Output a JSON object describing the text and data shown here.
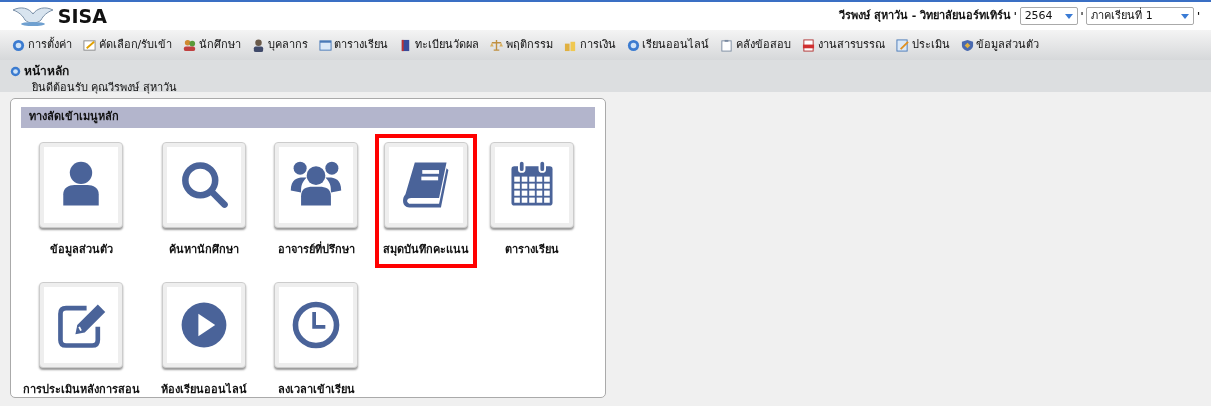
{
  "header": {
    "logo_text": "SISA",
    "user_school": "วีรพงษ์ สุหาวัน - วิทยาลัยนอร์ทเทิร์น",
    "separators": [
      "'",
      "'",
      "'"
    ],
    "year_select": {
      "value": "2564"
    },
    "term_select": {
      "value": "ภาคเรียนที่ 1"
    }
  },
  "menu": [
    {
      "label": "การตั้งค่า"
    },
    {
      "label": "คัดเลือก/รับเข้า"
    },
    {
      "label": "นักศึกษา"
    },
    {
      "label": "บุคลากร"
    },
    {
      "label": "ตารางเรียน"
    },
    {
      "label": "ทะเบียนวัดผล"
    },
    {
      "label": "พฤติกรรม"
    },
    {
      "label": "การเงิน"
    },
    {
      "label": "เรียนออนไลน์"
    },
    {
      "label": "คลังข้อสอบ"
    },
    {
      "label": "งานสารบรรณ"
    },
    {
      "label": "ประเมิน"
    },
    {
      "label": "ข้อมูลส่วนตัว"
    }
  ],
  "breadcrumb": {
    "title": "หน้าหลัก",
    "welcome": "ยินดีต้อนรับ คุณวีรพงษ์ สุหาวัน"
  },
  "shortcuts": {
    "title": "ทางลัดเข้าเมนูหลัก",
    "items": [
      {
        "label": "ข้อมูลส่วนตัว",
        "highlighted": false
      },
      {
        "label": "ค้นหานักศึกษา",
        "highlighted": false
      },
      {
        "label": "อาจารย์ที่ปรึกษา",
        "highlighted": false
      },
      {
        "label": "สมุดบันทึกคะแนน",
        "highlighted": true
      },
      {
        "label": "ตารางเรียน",
        "highlighted": false
      },
      {
        "label": "การประเมินหลังการสอน",
        "highlighted": false
      },
      {
        "label": "ห้องเรียนออนไลน์",
        "highlighted": false
      },
      {
        "label": "ลงเวลาเข้าเรียน",
        "highlighted": false
      }
    ]
  }
}
